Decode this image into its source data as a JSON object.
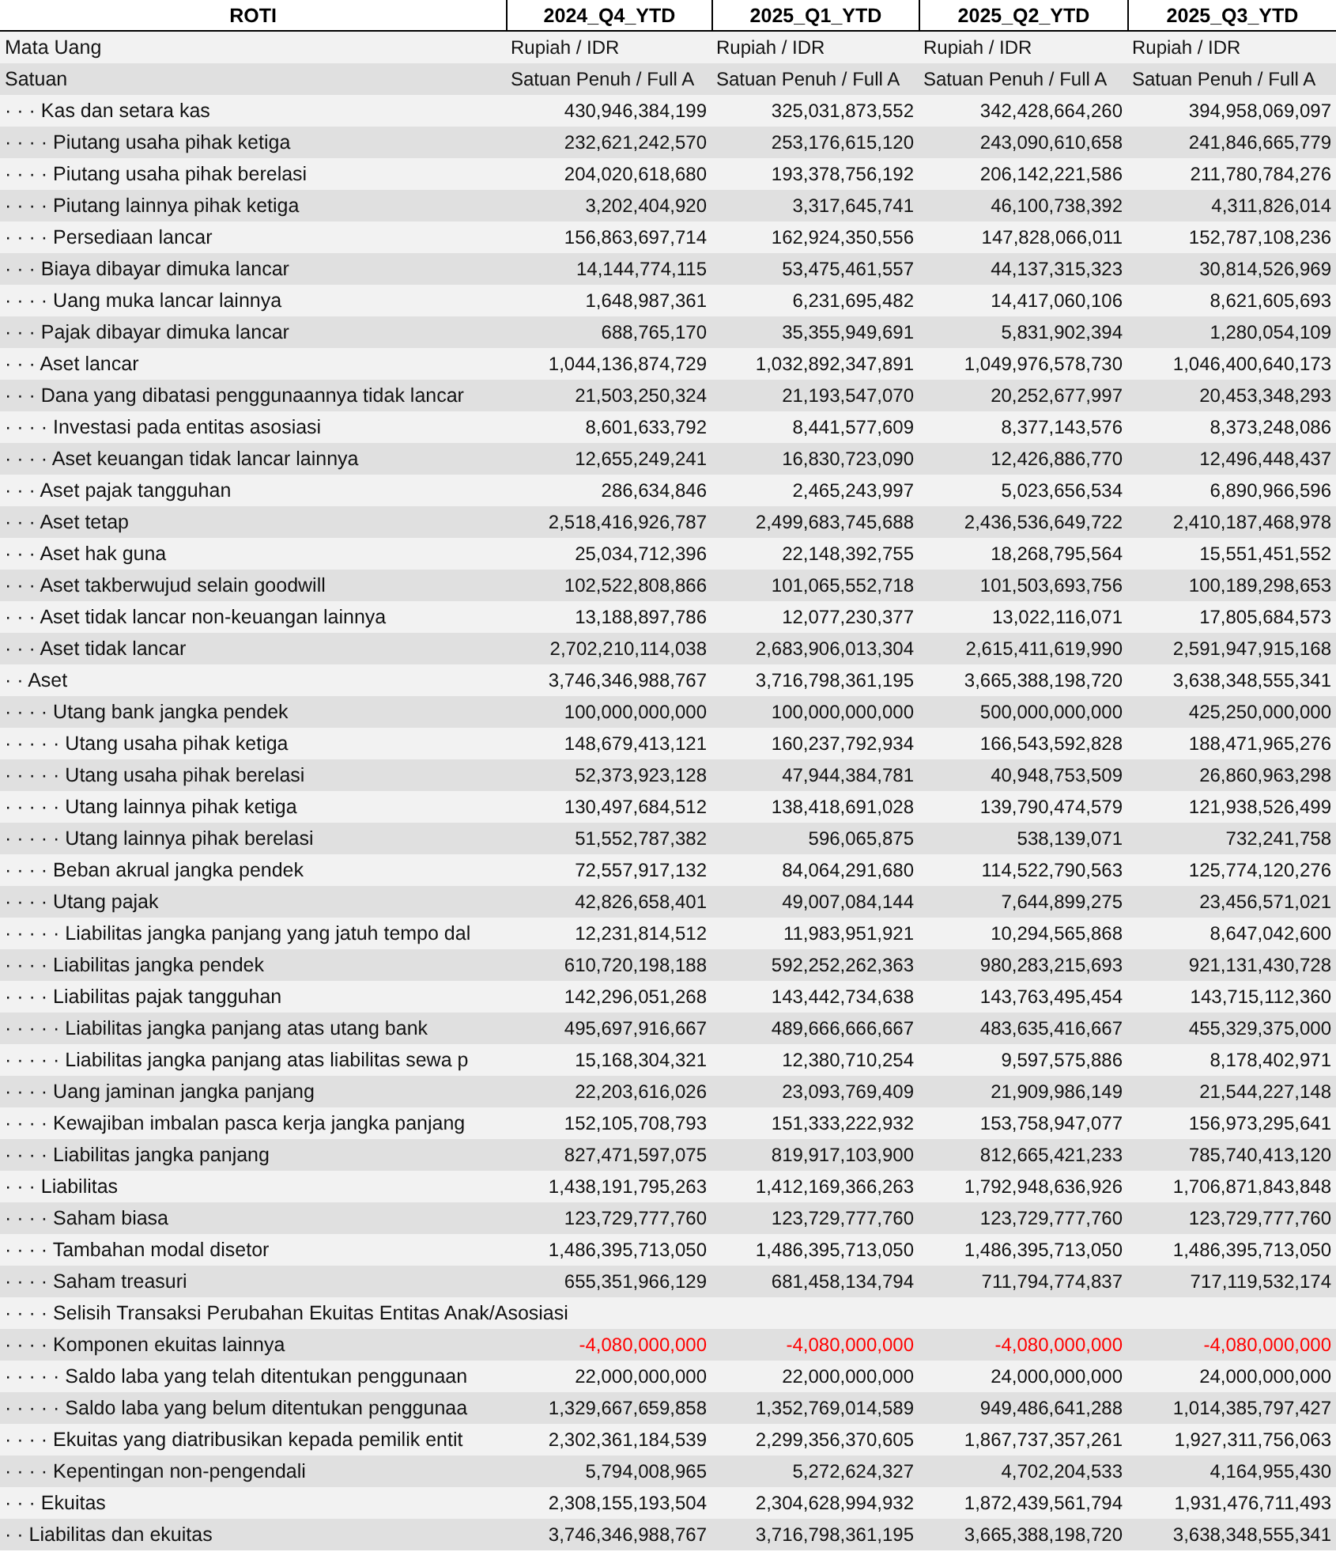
{
  "columns": [
    "ROTI",
    "2024_Q4_YTD",
    "2025_Q1_YTD",
    "2025_Q2_YTD",
    "2025_Q3_YTD"
  ],
  "rows": [
    {
      "label": "Mata Uang",
      "values": [
        "Rupiah / IDR",
        "Rupiah / IDR",
        "Rupiah / IDR",
        "Rupiah / IDR"
      ],
      "negative": false,
      "kind": "meta"
    },
    {
      "label": "Satuan",
      "values": [
        "Satuan Penuh / Full A",
        "Satuan Penuh / Full A",
        "Satuan Penuh / Full A",
        "Satuan Penuh / Full A"
      ],
      "negative": false,
      "kind": "meta"
    },
    {
      "label": "· · · Kas dan setara kas",
      "values": [
        "430,946,384,199",
        "325,031,873,552",
        "342,428,664,260",
        "394,958,069,097"
      ],
      "negative": false,
      "kind": "amount"
    },
    {
      "label": "· · · · Piutang usaha pihak ketiga",
      "values": [
        "232,621,242,570",
        "253,176,615,120",
        "243,090,610,658",
        "241,846,665,779"
      ],
      "negative": false,
      "kind": "amount"
    },
    {
      "label": "· · · · Piutang usaha pihak berelasi",
      "values": [
        "204,020,618,680",
        "193,378,756,192",
        "206,142,221,586",
        "211,780,784,276"
      ],
      "negative": false,
      "kind": "amount"
    },
    {
      "label": "· · · · Piutang lainnya pihak ketiga",
      "values": [
        "3,202,404,920",
        "3,317,645,741",
        "46,100,738,392",
        "4,311,826,014"
      ],
      "negative": false,
      "kind": "amount"
    },
    {
      "label": "· · · · Persediaan lancar",
      "values": [
        "156,863,697,714",
        "162,924,350,556",
        "147,828,066,011",
        "152,787,108,236"
      ],
      "negative": false,
      "kind": "amount"
    },
    {
      "label": "· · · Biaya dibayar dimuka lancar",
      "values": [
        "14,144,774,115",
        "53,475,461,557",
        "44,137,315,323",
        "30,814,526,969"
      ],
      "negative": false,
      "kind": "amount"
    },
    {
      "label": "· · · · Uang muka lancar lainnya",
      "values": [
        "1,648,987,361",
        "6,231,695,482",
        "14,417,060,106",
        "8,621,605,693"
      ],
      "negative": false,
      "kind": "amount"
    },
    {
      "label": "· · · Pajak dibayar dimuka lancar",
      "values": [
        "688,765,170",
        "35,355,949,691",
        "5,831,902,394",
        "1,280,054,109"
      ],
      "negative": false,
      "kind": "amount"
    },
    {
      "label": "· · · Aset lancar",
      "values": [
        "1,044,136,874,729",
        "1,032,892,347,891",
        "1,049,976,578,730",
        "1,046,400,640,173"
      ],
      "negative": false,
      "kind": "amount"
    },
    {
      "label": "· · · Dana yang dibatasi penggunaannya tidak lancar",
      "values": [
        "21,503,250,324",
        "21,193,547,070",
        "20,252,677,997",
        "20,453,348,293"
      ],
      "negative": false,
      "kind": "amount"
    },
    {
      "label": "· · · · Investasi pada entitas asosiasi",
      "values": [
        "8,601,633,792",
        "8,441,577,609",
        "8,377,143,576",
        "8,373,248,086"
      ],
      "negative": false,
      "kind": "amount"
    },
    {
      "label": "· · · · Aset keuangan tidak lancar lainnya",
      "values": [
        "12,655,249,241",
        "16,830,723,090",
        "12,426,886,770",
        "12,496,448,437"
      ],
      "negative": false,
      "kind": "amount"
    },
    {
      "label": "· · · Aset pajak tangguhan",
      "values": [
        "286,634,846",
        "2,465,243,997",
        "5,023,656,534",
        "6,890,966,596"
      ],
      "negative": false,
      "kind": "amount"
    },
    {
      "label": "· · · Aset tetap",
      "values": [
        "2,518,416,926,787",
        "2,499,683,745,688",
        "2,436,536,649,722",
        "2,410,187,468,978"
      ],
      "negative": false,
      "kind": "amount"
    },
    {
      "label": "· · · Aset hak guna",
      "values": [
        "25,034,712,396",
        "22,148,392,755",
        "18,268,795,564",
        "15,551,451,552"
      ],
      "negative": false,
      "kind": "amount"
    },
    {
      "label": "· · · Aset takberwujud selain goodwill",
      "values": [
        "102,522,808,866",
        "101,065,552,718",
        "101,503,693,756",
        "100,189,298,653"
      ],
      "negative": false,
      "kind": "amount"
    },
    {
      "label": "· · · Aset tidak lancar non-keuangan lainnya",
      "values": [
        "13,188,897,786",
        "12,077,230,377",
        "13,022,116,071",
        "17,805,684,573"
      ],
      "negative": false,
      "kind": "amount"
    },
    {
      "label": "· · · Aset tidak lancar",
      "values": [
        "2,702,210,114,038",
        "2,683,906,013,304",
        "2,615,411,619,990",
        "2,591,947,915,168"
      ],
      "negative": false,
      "kind": "amount"
    },
    {
      "label": "· · Aset",
      "values": [
        "3,746,346,988,767",
        "3,716,798,361,195",
        "3,665,388,198,720",
        "3,638,348,555,341"
      ],
      "negative": false,
      "kind": "amount"
    },
    {
      "label": "· · · · Utang bank jangka pendek",
      "values": [
        "100,000,000,000",
        "100,000,000,000",
        "500,000,000,000",
        "425,250,000,000"
      ],
      "negative": false,
      "kind": "amount"
    },
    {
      "label": "· · · · · Utang usaha pihak ketiga",
      "values": [
        "148,679,413,121",
        "160,237,792,934",
        "166,543,592,828",
        "188,471,965,276"
      ],
      "negative": false,
      "kind": "amount"
    },
    {
      "label": "· · · · · Utang usaha pihak berelasi",
      "values": [
        "52,373,923,128",
        "47,944,384,781",
        "40,948,753,509",
        "26,860,963,298"
      ],
      "negative": false,
      "kind": "amount"
    },
    {
      "label": "· · · · · Utang lainnya pihak ketiga",
      "values": [
        "130,497,684,512",
        "138,418,691,028",
        "139,790,474,579",
        "121,938,526,499"
      ],
      "negative": false,
      "kind": "amount"
    },
    {
      "label": "· · · · · Utang lainnya pihak berelasi",
      "values": [
        "51,552,787,382",
        "596,065,875",
        "538,139,071",
        "732,241,758"
      ],
      "negative": false,
      "kind": "amount"
    },
    {
      "label": "· · · · Beban akrual jangka pendek",
      "values": [
        "72,557,917,132",
        "84,064,291,680",
        "114,522,790,563",
        "125,774,120,276"
      ],
      "negative": false,
      "kind": "amount"
    },
    {
      "label": "· · · · Utang pajak",
      "values": [
        "42,826,658,401",
        "49,007,084,144",
        "7,644,899,275",
        "23,456,571,021"
      ],
      "negative": false,
      "kind": "amount"
    },
    {
      "label": "· · · · · Liabilitas jangka panjang yang jatuh tempo dal",
      "values": [
        "12,231,814,512",
        "11,983,951,921",
        "10,294,565,868",
        "8,647,042,600"
      ],
      "negative": false,
      "kind": "amount"
    },
    {
      "label": "· · · · Liabilitas jangka pendek",
      "values": [
        "610,720,198,188",
        "592,252,262,363",
        "980,283,215,693",
        "921,131,430,728"
      ],
      "negative": false,
      "kind": "amount"
    },
    {
      "label": "· · · · Liabilitas pajak tangguhan",
      "values": [
        "142,296,051,268",
        "143,442,734,638",
        "143,763,495,454",
        "143,715,112,360"
      ],
      "negative": false,
      "kind": "amount"
    },
    {
      "label": "· · · · · Liabilitas jangka panjang atas utang bank",
      "values": [
        "495,697,916,667",
        "489,666,666,667",
        "483,635,416,667",
        "455,329,375,000"
      ],
      "negative": false,
      "kind": "amount"
    },
    {
      "label": "· · · · · Liabilitas jangka panjang atas liabilitas sewa p",
      "values": [
        "15,168,304,321",
        "12,380,710,254",
        "9,597,575,886",
        "8,178,402,971"
      ],
      "negative": false,
      "kind": "amount"
    },
    {
      "label": "· · · · Uang jaminan jangka panjang",
      "values": [
        "22,203,616,026",
        "23,093,769,409",
        "21,909,986,149",
        "21,544,227,148"
      ],
      "negative": false,
      "kind": "amount"
    },
    {
      "label": "· · · · Kewajiban imbalan pasca kerja jangka panjang",
      "values": [
        "152,105,708,793",
        "151,333,222,932",
        "153,758,947,077",
        "156,973,295,641"
      ],
      "negative": false,
      "kind": "amount"
    },
    {
      "label": "· · · · Liabilitas jangka panjang",
      "values": [
        "827,471,597,075",
        "819,917,103,900",
        "812,665,421,233",
        "785,740,413,120"
      ],
      "negative": false,
      "kind": "amount"
    },
    {
      "label": "· · · Liabilitas",
      "values": [
        "1,438,191,795,263",
        "1,412,169,366,263",
        "1,792,948,636,926",
        "1,706,871,843,848"
      ],
      "negative": false,
      "kind": "amount"
    },
    {
      "label": "· · · · Saham biasa",
      "values": [
        "123,729,777,760",
        "123,729,777,760",
        "123,729,777,760",
        "123,729,777,760"
      ],
      "negative": false,
      "kind": "amount"
    },
    {
      "label": "· · · · Tambahan modal disetor",
      "values": [
        "1,486,395,713,050",
        "1,486,395,713,050",
        "1,486,395,713,050",
        "1,486,395,713,050"
      ],
      "negative": false,
      "kind": "amount"
    },
    {
      "label": "· · · · Saham treasuri",
      "values": [
        "655,351,966,129",
        "681,458,134,794",
        "711,794,774,837",
        "717,119,532,174"
      ],
      "negative": false,
      "kind": "amount"
    },
    {
      "label": "· · · · Selisih Transaksi Perubahan Ekuitas Entitas Anak/Asosiasi",
      "values": [],
      "negative": false
    },
    {
      "label": "· · · · Komponen ekuitas lainnya",
      "values": [
        "-4,080,000,000",
        "-4,080,000,000",
        "-4,080,000,000",
        "-4,080,000,000"
      ],
      "negative": true,
      "kind": "amount"
    },
    {
      "label": "· · · · · Saldo laba yang telah ditentukan penggunaan",
      "values": [
        "22,000,000,000",
        "22,000,000,000",
        "24,000,000,000",
        "24,000,000,000"
      ],
      "negative": false,
      "kind": "amount"
    },
    {
      "label": "· · · · · Saldo laba yang belum ditentukan penggunaa",
      "values": [
        "1,329,667,659,858",
        "1,352,769,014,589",
        "949,486,641,288",
        "1,014,385,797,427"
      ],
      "negative": false,
      "kind": "amount"
    },
    {
      "label": "· · · · Ekuitas yang diatribusikan kepada pemilik entit",
      "values": [
        "2,302,361,184,539",
        "2,299,356,370,605",
        "1,867,737,357,261",
        "1,927,311,756,063"
      ],
      "negative": false,
      "kind": "amount"
    },
    {
      "label": "· · · · Kepentingan non-pengendali",
      "values": [
        "5,794,008,965",
        "5,272,624,327",
        "4,702,204,533",
        "4,164,955,430"
      ],
      "negative": false,
      "kind": "amount"
    },
    {
      "label": "· · · Ekuitas",
      "values": [
        "2,308,155,193,504",
        "2,304,628,994,932",
        "1,872,439,561,794",
        "1,931,476,711,493"
      ],
      "negative": false,
      "kind": "amount"
    },
    {
      "label": "· · Liabilitas dan ekuitas",
      "values": [
        "3,746,346,988,767",
        "3,716,798,361,195",
        "3,665,388,198,720",
        "3,638,348,555,341"
      ],
      "negative": false,
      "kind": "amount"
    }
  ]
}
